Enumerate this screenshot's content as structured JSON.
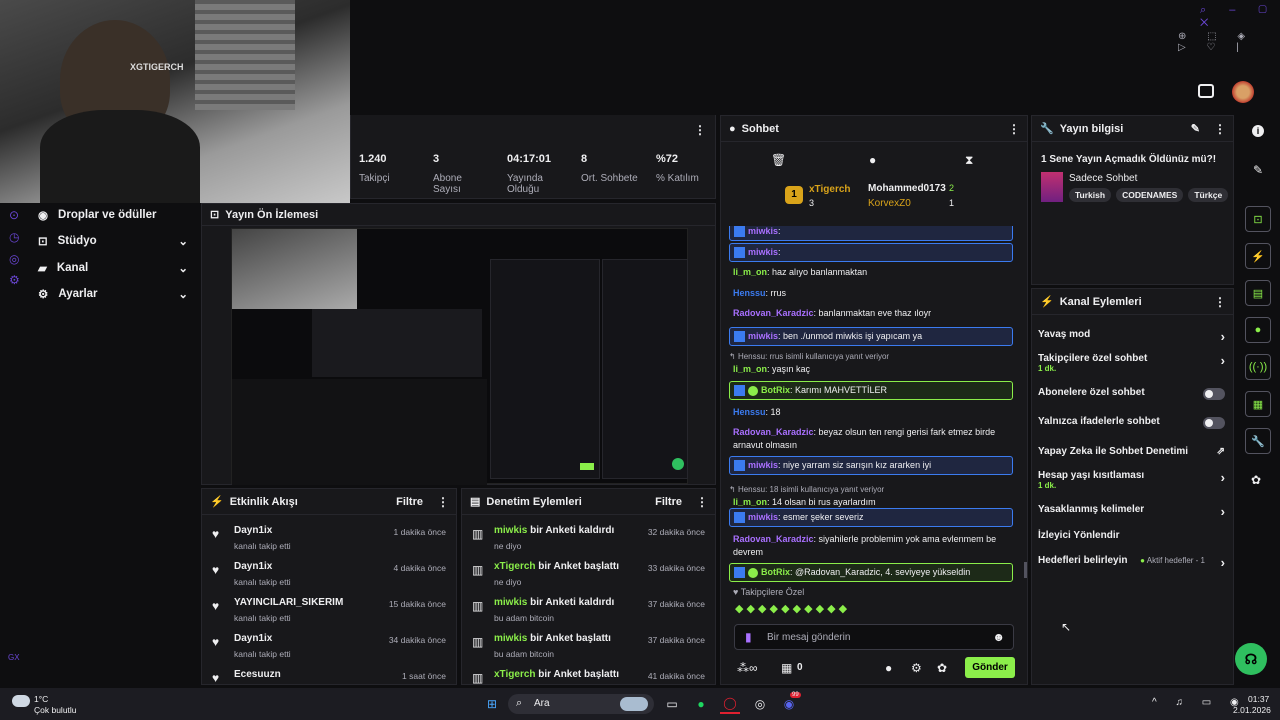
{
  "webcam": {
    "overlay": "XGTIGERCH"
  },
  "stats": [
    {
      "value": "1.240",
      "label": "Takipçi"
    },
    {
      "value": "3",
      "label": "Abone Sayısı"
    },
    {
      "value": "04:17:01",
      "label": "Yayında Olduğu"
    },
    {
      "value": "8",
      "label": "Ort. Sohbete"
    },
    {
      "value": "%72",
      "label": "% Katılım"
    }
  ],
  "sidebar": {
    "items": [
      {
        "label": "Droplar ve ödüller"
      },
      {
        "label": "Stüdyo"
      },
      {
        "label": "Kanal"
      },
      {
        "label": "Ayarlar"
      }
    ],
    "footer": "GX"
  },
  "preview": {
    "title": "Yayın Ön İzlemesi"
  },
  "activity": {
    "title": "Etkinlik Akışı",
    "filter": "Filtre",
    "events": [
      {
        "name": "Dayn1ix",
        "sub": "kanalı takip etti",
        "time": "1 dakika önce"
      },
      {
        "name": "Dayn1ix",
        "sub": "kanalı takip etti",
        "time": "4 dakika önce"
      },
      {
        "name": "YAYINCILARI_SIKERIM",
        "sub": "kanalı takip etti",
        "time": "15 dakika önce"
      },
      {
        "name": "Dayn1ix",
        "sub": "kanalı takip etti",
        "time": "34 dakika önce"
      },
      {
        "name": "Ecesuuzn",
        "sub": "",
        "time": "1 saat önce"
      }
    ]
  },
  "moderation": {
    "title": "Denetim Eylemleri",
    "filter": "Filtre",
    "events": [
      {
        "user": "miwkis",
        "action": "bir Anketi kaldırdı",
        "sub": "ne diyo",
        "time": "32 dakika önce"
      },
      {
        "user": "xTigerch",
        "action": "bir Anket başlattı",
        "sub": "ne diyo",
        "time": "33 dakika önce"
      },
      {
        "user": "miwkis",
        "action": "bir Anketi kaldırdı",
        "sub": "bu adam bitcoin",
        "time": "37 dakika önce"
      },
      {
        "user": "miwkis",
        "action": "bir Anket başlattı",
        "sub": "bu adam bitcoin",
        "time": "37 dakika önce"
      },
      {
        "user": "xTigerch",
        "action": "bir Anket başlattı",
        "sub": "",
        "time": "41 dakika önce"
      }
    ]
  },
  "chat": {
    "title": "Sohbet",
    "leaders": [
      {
        "rank": "1",
        "name": "xTigerch",
        "score": "3"
      },
      {
        "name": "Mohammed0173",
        "score": "2"
      },
      {
        "name": "KorvexZ0",
        "score": "1"
      }
    ],
    "messages": [
      {
        "user": "miwkis",
        "text": "",
        "box": "b"
      },
      {
        "user": "miwkis",
        "text": "",
        "box": "b"
      },
      {
        "user": "li_m_on",
        "text": "haz alıyo banlanmaktan"
      },
      {
        "user": "Henssu",
        "text": "rrus"
      },
      {
        "user": "Radovan_Karadzic",
        "text": "banlanmaktan eve thaz ıloyr"
      },
      {
        "user": "miwkis",
        "text": "ben ./unmod miwkis işi yapıcam ya",
        "box": "b"
      },
      {
        "reply": "Henssu: rrus isimli kullanıcıya yanıt veriyor",
        "user": "li_m_on",
        "text": "yaşın kaç"
      },
      {
        "user": "BotRix",
        "text": "Karımı MAHVETTİLER",
        "box": "g"
      },
      {
        "user": "Henssu",
        "text": "18"
      },
      {
        "user": "Radovan_Karadzic",
        "text": "beyaz olsun ten rengi gerisi fark etmez birde arnavut olmasın"
      },
      {
        "user": "miwkis",
        "text": "niye yarram siz sarışın kız ararken iyi",
        "box": "b"
      },
      {
        "reply": "Henssu: 18 isimli kullanıcıya yanıt veriyor",
        "user": "li_m_on",
        "text": "14 olsan bi rus ayarlardım"
      },
      {
        "user": "miwkis",
        "text": "esmer şeker severiz",
        "box": "b"
      },
      {
        "user": "Radovan_Karadzic",
        "text": "siyahilerle problemim yok ama evlenmem be devrem"
      },
      {
        "user": "BotRix",
        "text": "@Radovan_Karadzic, 4. seviyeye yükseldin",
        "box": "g"
      }
    ],
    "followers_only": "Takipçilere Özel",
    "placeholder": "Bir mesaj gönderin",
    "points": "0",
    "send": "Gönder"
  },
  "stream_info": {
    "title": "Yayın bilgisi",
    "stream_title": "1 Sene Yayın Açmadık Öldünüz mü?!",
    "category": "Sadece Sohbet",
    "tags": [
      "Turkish",
      "CODENAMES",
      "Türkçe"
    ]
  },
  "channel_actions": {
    "title": "Kanal Eylemleri",
    "items": [
      {
        "label": "Yavaş mod",
        "type": "chev"
      },
      {
        "label": "Takipçilere özel sohbet",
        "sub": "1 dk.",
        "type": "chev"
      },
      {
        "label": "Abonelere özel sohbet",
        "type": "toggle"
      },
      {
        "label": "Yalnızca ifadelerle sohbet",
        "type": "toggle"
      },
      {
        "label": "Yapay Zeka ile Sohbet Denetimi",
        "type": "ext"
      },
      {
        "label": "Hesap yaşı kısıtlaması",
        "sub": "1 dk.",
        "type": "chev"
      },
      {
        "label": "Yasaklanmış kelimeler",
        "type": "chev"
      },
      {
        "label": "İzleyici Yönlendir",
        "type": "none"
      },
      {
        "label": "Hedefleri belirleyin",
        "extra": "Aktif hedefler - 1",
        "type": "chev"
      }
    ]
  },
  "taskbar": {
    "weather_temp": "1°C",
    "weather_desc": "Çok bulutlu",
    "search": "Ara",
    "time": "01:37",
    "date": "2.01.2026",
    "badge": "99"
  },
  "colors": {
    "accent": "#8bee4a",
    "user_blue": "#3b7bf0",
    "purple": "#a970ff"
  }
}
